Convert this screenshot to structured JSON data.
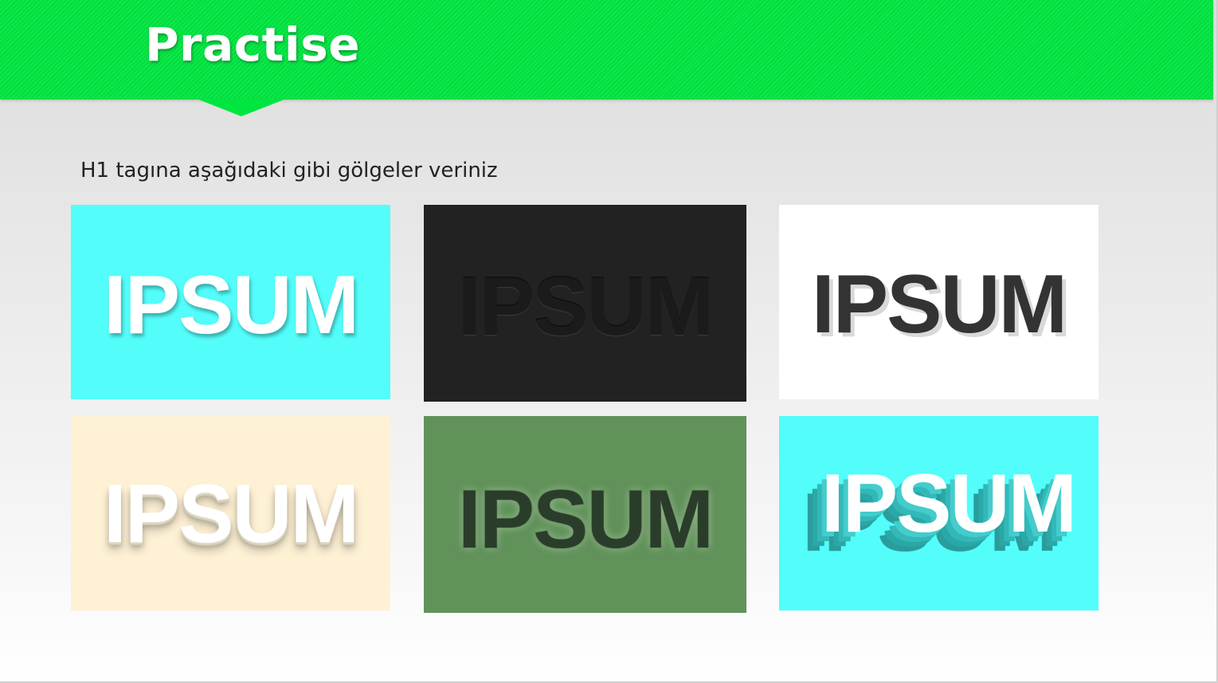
{
  "slide": {
    "title": "Practise",
    "instruction": "H1 tagına aşağıdaki gibi gölgeler veriniz"
  },
  "examples": [
    {
      "text": "IPSUM",
      "background": "#52fdfa",
      "text_color": "#ffffff"
    },
    {
      "text": "IPSUM",
      "background": "#222222",
      "text_color": "#1b1b1b"
    },
    {
      "text": "IPSUM",
      "background": "#ffffff",
      "text_color": "#333333"
    },
    {
      "text": "IPSUM",
      "background": "#fef1d4",
      "text_color": "#ffffff"
    },
    {
      "text": "IPSUM",
      "background": "#61925a",
      "text_color": "#2a3d2a"
    },
    {
      "text": "IPSUM",
      "background": "#52fdfa",
      "text_color": "#ffffff"
    }
  ],
  "colors": {
    "header": "#00e640",
    "title_text": "#ffffff",
    "body_text": "#222222"
  }
}
